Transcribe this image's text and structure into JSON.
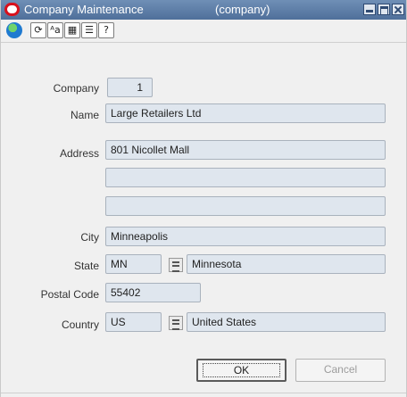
{
  "window": {
    "title": "Company Maintenance",
    "subtitle": "(company)"
  },
  "toolbar": {
    "icons": [
      "globe-icon",
      "sync-icon",
      "spell-check-icon",
      "calendar-icon",
      "notes-icon",
      "help-icon"
    ]
  },
  "form": {
    "company_label": "Company",
    "company_value": "1",
    "name_label": "Name",
    "name_value": "Large Retailers Ltd",
    "address_label": "Address",
    "address_line1": "801 Nicollet Mall",
    "address_line2": "",
    "address_line3": "",
    "city_label": "City",
    "city_value": "Minneapolis",
    "state_label": "State",
    "state_code": "MN",
    "state_name": "Minnesota",
    "postal_label": "Postal Code",
    "postal_value": "55402",
    "country_label": "Country",
    "country_code": "US",
    "country_name": "United States"
  },
  "buttons": {
    "ok_label": "OK",
    "cancel_label": "Cancel"
  },
  "colors": {
    "titlebar": "#5a7aa5",
    "field_background": "#dfe6ee",
    "logo_red": "#d8101c"
  }
}
